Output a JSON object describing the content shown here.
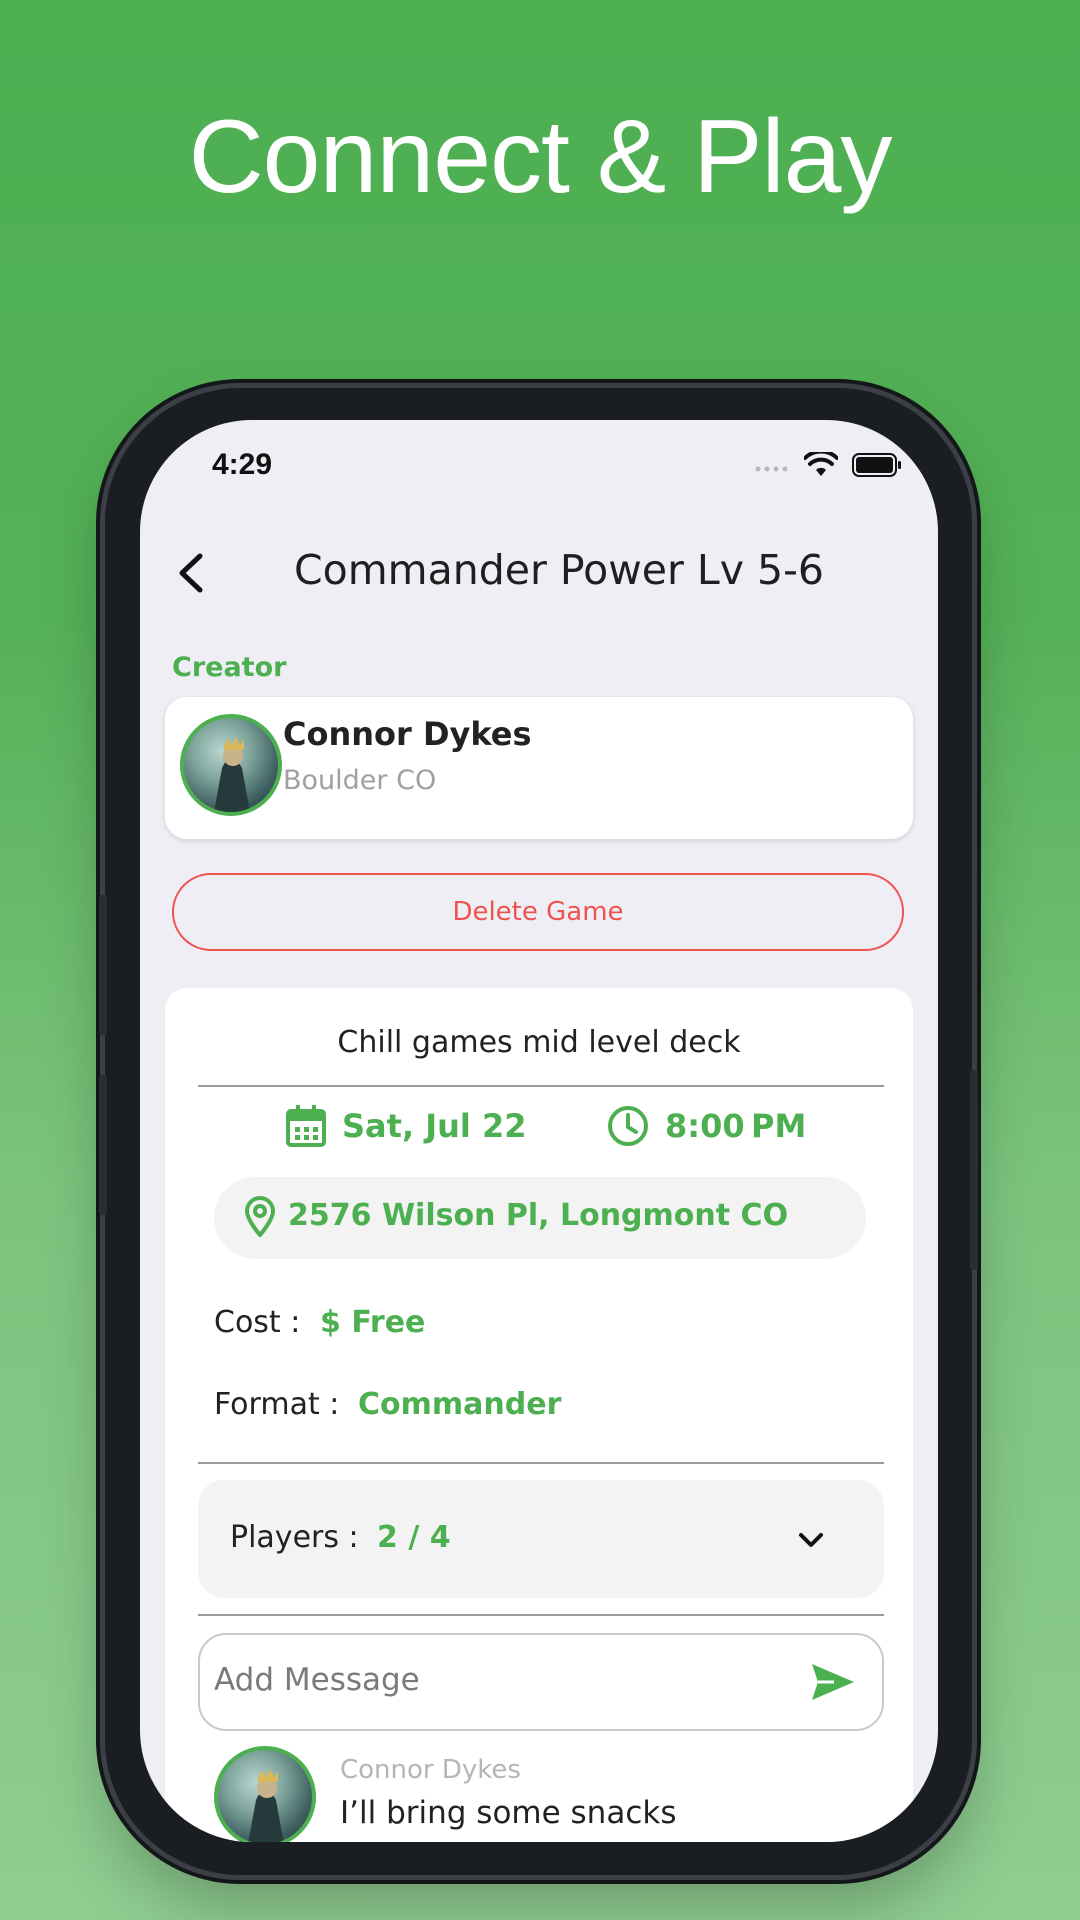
{
  "headline": "Connect & Play",
  "status_bar": {
    "time": "4:29"
  },
  "nav": {
    "title": "Commander Power Lv 5-6"
  },
  "creator": {
    "section_label": "Creator",
    "name": "Connor Dykes",
    "location": "Boulder CO"
  },
  "actions": {
    "delete_label": "Delete Game"
  },
  "game": {
    "description": "Chill games mid level deck",
    "date": "Sat, Jul 22",
    "time": "8:00 PM",
    "address": "2576 Wilson Pl, Longmont CO",
    "cost_label": "Cost :",
    "cost_value": "$ Free",
    "format_label": "Format :",
    "format_value": "Commander",
    "players_label": "Players :",
    "players_value": "2 / 4"
  },
  "chat": {
    "placeholder": "Add Message",
    "messages": [
      {
        "author": "Connor Dykes",
        "text": "I’ll bring some snacks"
      }
    ]
  },
  "colors": {
    "accent": "#4caf50",
    "danger": "#ef5350",
    "background": "#4caf50"
  },
  "icons": [
    "chevron-left-icon",
    "wifi-icon",
    "battery-icon",
    "calendar-icon",
    "clock-icon",
    "location-pin-icon",
    "chevron-down-icon",
    "send-icon"
  ]
}
